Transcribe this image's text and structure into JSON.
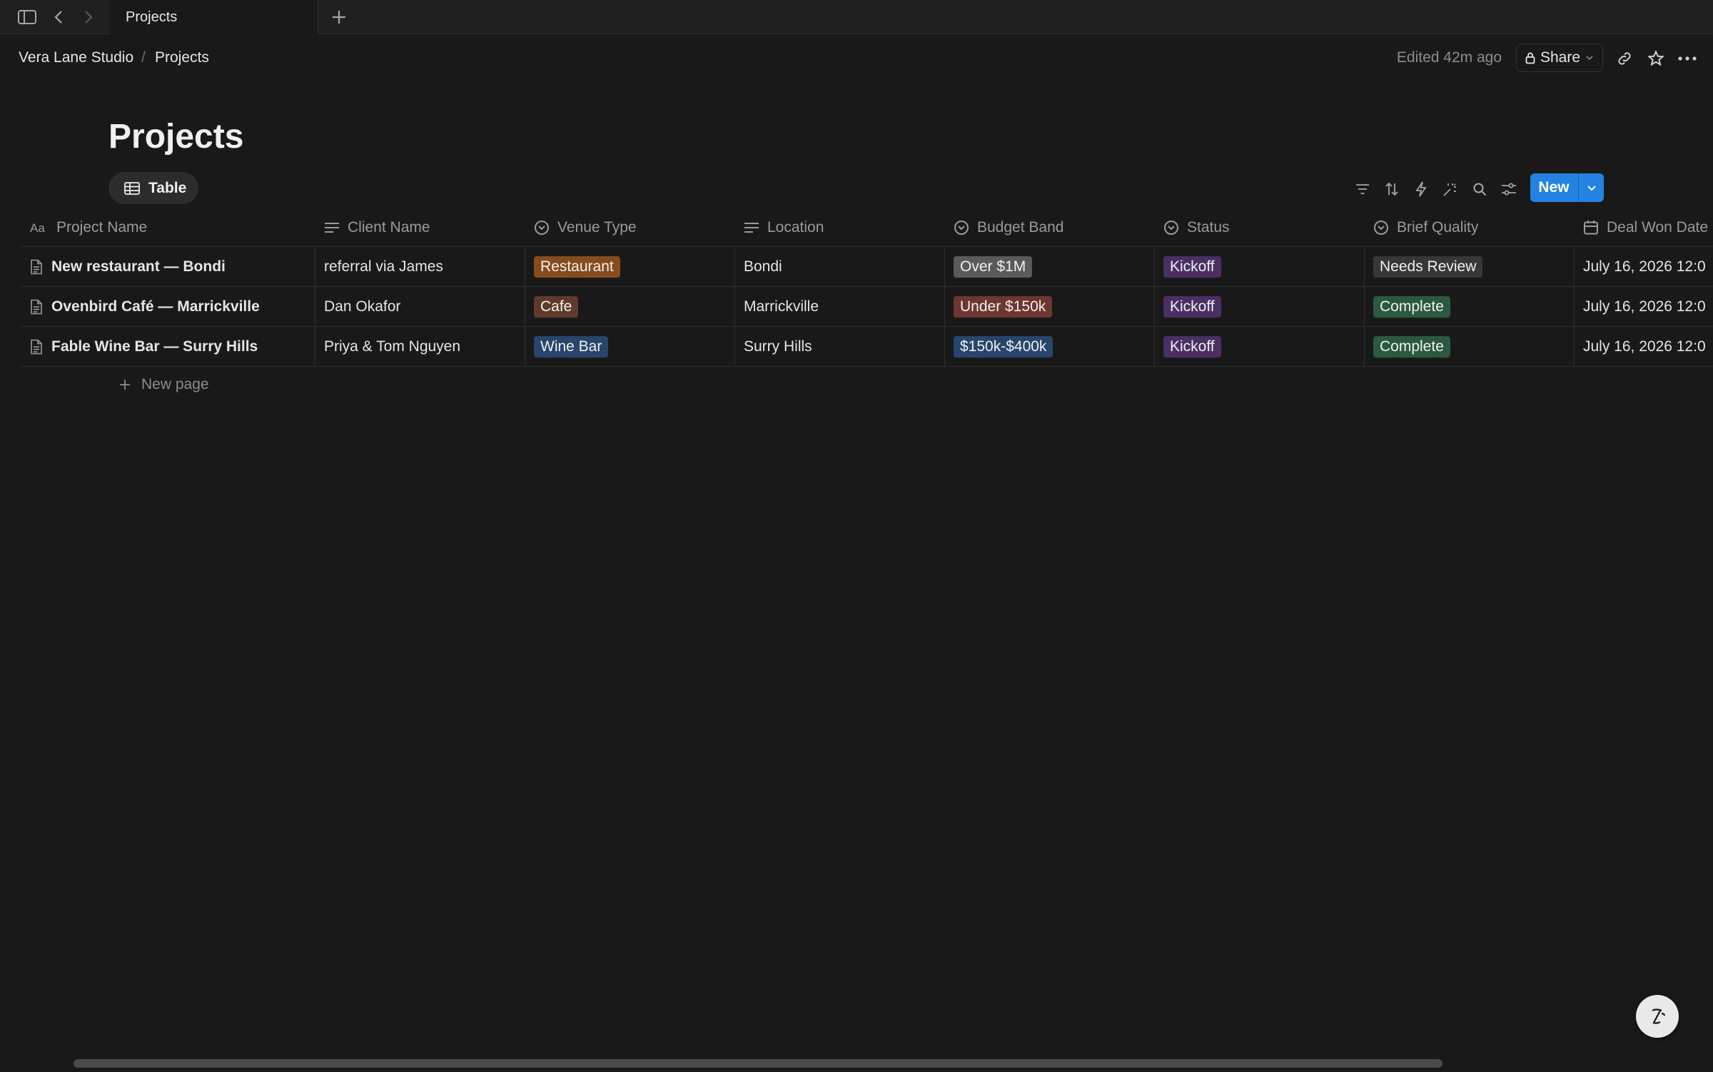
{
  "tab": {
    "title": "Projects"
  },
  "breadcrumb": {
    "workspace": "Vera Lane Studio",
    "separator": "/",
    "page": "Projects"
  },
  "header": {
    "edited": "Edited 42m ago",
    "share_label": "Share"
  },
  "page": {
    "title": "Projects",
    "view_label": "Table",
    "new_label": "New",
    "new_page_label": "New page"
  },
  "columns": [
    {
      "label": "Project Name",
      "icon": "title-icon"
    },
    {
      "label": "Client Name",
      "icon": "text-icon"
    },
    {
      "label": "Venue Type",
      "icon": "select-icon"
    },
    {
      "label": "Location",
      "icon": "text-icon"
    },
    {
      "label": "Budget Band",
      "icon": "select-icon"
    },
    {
      "label": "Status",
      "icon": "select-icon"
    },
    {
      "label": "Brief Quality",
      "icon": "select-icon"
    },
    {
      "label": "Deal Won Date",
      "icon": "calendar-icon"
    }
  ],
  "rows": [
    {
      "name": "New restaurant — Bondi",
      "client": "referral via James",
      "venue": "Restaurant",
      "location": "Bondi",
      "budget": "Over $1M",
      "status": "Kickoff",
      "brief": "Needs Review",
      "date": "July 16, 2026 12:0"
    },
    {
      "name": "Ovenbird Café — Marrickville",
      "client": "Dan Okafor",
      "venue": "Cafe",
      "location": "Marrickville",
      "budget": "Under $150k",
      "status": "Kickoff",
      "brief": "Complete",
      "date": "July 16, 2026 12:0"
    },
    {
      "name": "Fable Wine Bar — Surry Hills",
      "client": "Priya & Tom Nguyen",
      "venue": "Wine Bar",
      "location": "Surry Hills",
      "budget": "$150k-$400k",
      "status": "Kickoff",
      "brief": "Complete",
      "date": "July 16, 2026 12:0"
    }
  ],
  "tag_colors": {
    "Restaurant": "#854c1d",
    "Cafe": "#603b2c",
    "Wine Bar": "#28456c",
    "Over $1M": "#5a5a5a",
    "Under $150k": "#6e3630",
    "$150k-$400k": "#28456c",
    "Kickoff": "#492f64",
    "Needs Review": "#373737",
    "Complete": "#2b593f"
  },
  "accent": "#2383e2"
}
